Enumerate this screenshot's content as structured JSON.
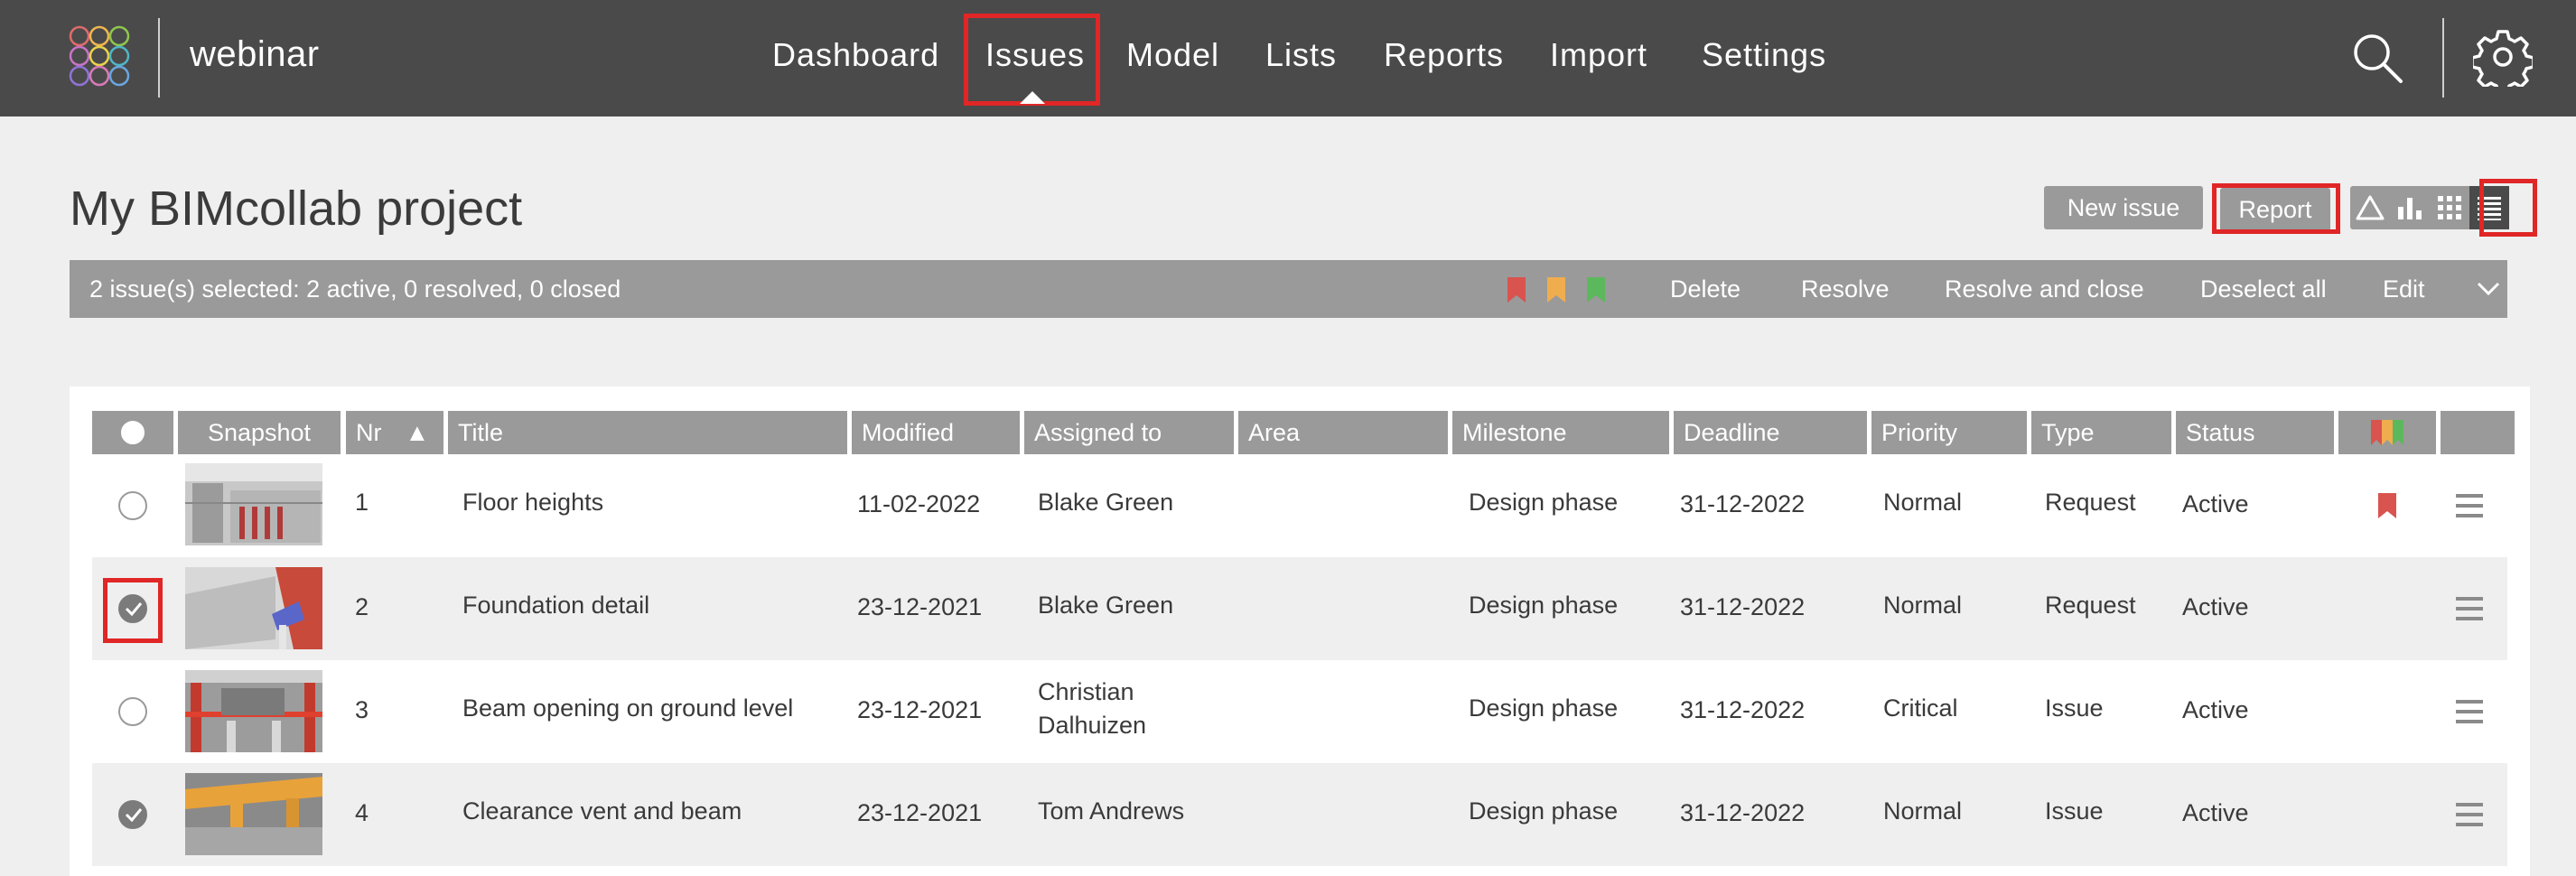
{
  "app": {
    "name": "webinar"
  },
  "nav": {
    "items": [
      "Dashboard",
      "Issues",
      "Model",
      "Lists",
      "Reports",
      "Import",
      "Settings"
    ],
    "active": "Issues"
  },
  "page": {
    "title": "My BIMcollab project"
  },
  "toolbar": {
    "new_issue": "New issue",
    "report": "Report",
    "views": [
      "triangle-view-icon",
      "bar-chart-view-icon",
      "grid-view-icon",
      "list-view-icon"
    ],
    "active_view": "list-view-icon"
  },
  "selection_bar": {
    "summary": "2 issue(s) selected: 2 active, 0 resolved, 0 closed",
    "flag_colors": [
      "#d9534f",
      "#f0ad4e",
      "#5cb85c"
    ],
    "actions": [
      "Delete",
      "Resolve",
      "Resolve and close",
      "Deselect all",
      "Edit"
    ]
  },
  "table": {
    "headers": [
      "Snapshot",
      "Nr",
      "Title",
      "Modified",
      "Assigned to",
      "Area",
      "Milestone",
      "Deadline",
      "Priority",
      "Type",
      "Status"
    ],
    "sort_indicator": "▲",
    "rows": [
      {
        "nr": "1",
        "title": "Floor heights",
        "modified": "11-02-2022",
        "assigned": "Blake Green",
        "area": "",
        "milestone": "Design phase",
        "deadline": "31-12-2022",
        "priority": "Normal",
        "type": "Request",
        "status": "Active",
        "checked": false,
        "flag": "#d9534f"
      },
      {
        "nr": "2",
        "title": "Foundation detail",
        "modified": "23-12-2021",
        "assigned": "Blake Green",
        "area": "",
        "milestone": "Design phase",
        "deadline": "31-12-2022",
        "priority": "Normal",
        "type": "Request",
        "status": "Active",
        "checked": true,
        "flag": ""
      },
      {
        "nr": "3",
        "title": "Beam opening on ground level",
        "modified": "23-12-2021",
        "assigned": "Christian Dalhuizen",
        "area": "",
        "milestone": "Design phase",
        "deadline": "31-12-2022",
        "priority": "Critical",
        "type": "Issue",
        "status": "Active",
        "checked": false,
        "flag": ""
      },
      {
        "nr": "4",
        "title": "Clearance vent and beam",
        "modified": "23-12-2021",
        "assigned": "Tom Andrews",
        "area": "",
        "milestone": "Design phase",
        "deadline": "31-12-2022",
        "priority": "Normal",
        "type": "Issue",
        "status": "Active",
        "checked": true,
        "flag": ""
      }
    ]
  },
  "colors": {
    "topbar": "#4a4a4a",
    "accent_highlight": "#e02626",
    "header_gray": "#9a9a9a"
  }
}
